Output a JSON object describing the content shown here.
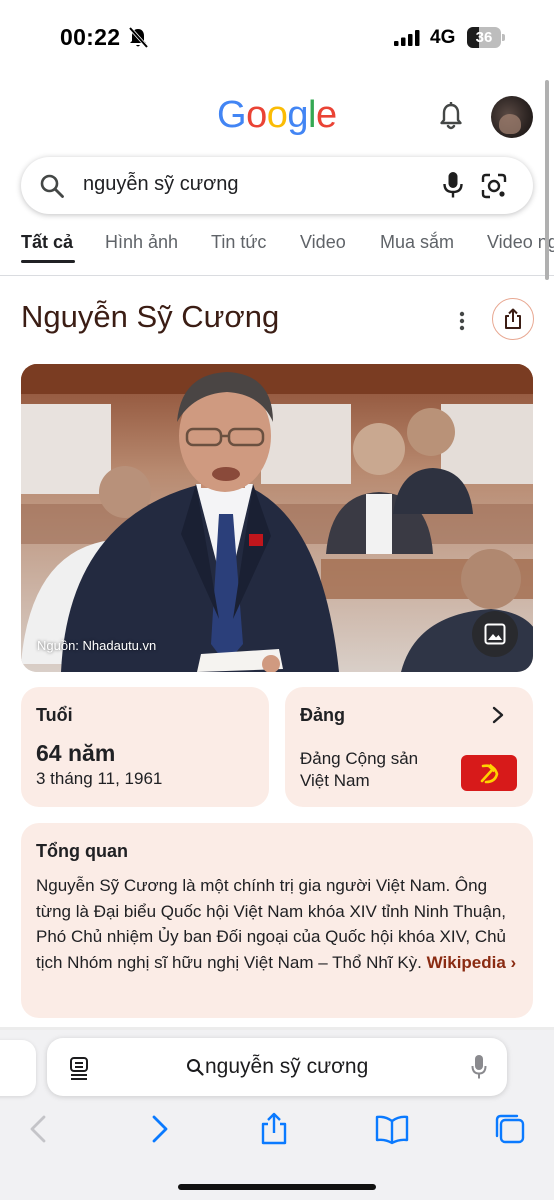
{
  "status_bar": {
    "time": "00:22",
    "network": "4G",
    "battery_level": "36",
    "battery_fraction": 0.36
  },
  "header": {
    "logo": [
      "G",
      "o",
      "o",
      "g",
      "l",
      "e"
    ],
    "logo_colors": [
      "#4285F4",
      "#EA4335",
      "#FBBC05",
      "#4285F4",
      "#34A853",
      "#EA4335"
    ]
  },
  "search": {
    "query": "nguyễn sỹ cương"
  },
  "tabs": [
    {
      "label": "Tất cả"
    },
    {
      "label": "Hình ảnh"
    },
    {
      "label": "Tin tức"
    },
    {
      "label": "Video"
    },
    {
      "label": "Mua sắm"
    },
    {
      "label": "Video ng"
    }
  ],
  "knowledge_panel": {
    "title": "Nguyễn Sỹ Cương",
    "photo_caption": "Nguồn: Nhadautu.vn",
    "age_card": {
      "label": "Tuổi",
      "value": "64 năm",
      "date": "3 tháng 11, 1961"
    },
    "party_card": {
      "label": "Đảng",
      "name": "Đảng Cộng sản Việt Nam"
    },
    "overview": {
      "label": "Tổng quan",
      "text": "Nguyễn Sỹ Cương là một chính trị gia người Việt Nam. Ông từng là Đại biểu Quốc hội Việt Nam khóa XIV tỉnh Ninh Thuận, Phó Chủ nhiệm Ủy ban Đối ngoại của Quốc hội khóa XIV, Chủ tịch Nhóm nghị sĩ hữu nghị Việt Nam – Thổ Nhĩ Kỳ.",
      "source_link": "Wikipedia ›"
    }
  },
  "safari": {
    "address_text": "nguyễn sỹ cương"
  },
  "colors": {
    "accent_brown": "#3b1d14",
    "card_bg": "#fbece6",
    "link_color": "#8a2b12",
    "safari_blue": "#0a7aff",
    "flag_red": "#d71a1a"
  }
}
